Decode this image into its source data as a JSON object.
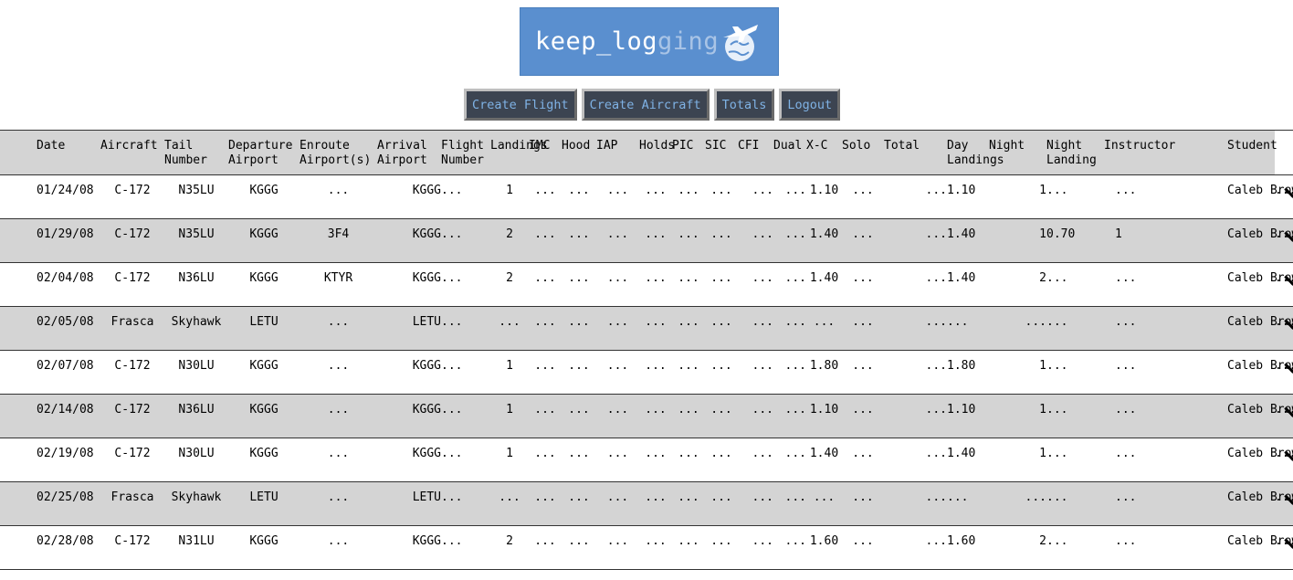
{
  "app": {
    "logo_main": "keep_log",
    "logo_fade": "ging",
    "logo_icon": "airplane-globe-icon"
  },
  "nav": {
    "create_flight": "Create Flight",
    "create_aircraft": "Create Aircraft",
    "totals": "Totals",
    "logout": "Logout"
  },
  "table": {
    "headers": [
      "Date",
      "Aircraft",
      "Tail Number",
      "Departure Airport",
      "Enroute Airport(s)",
      "Arrival Airport",
      "Flight Number",
      "Landings",
      "IMC",
      "Hood",
      "IAP",
      "Holds",
      "PIC",
      "SIC",
      "CFI",
      "Dual",
      "X-C",
      "Solo",
      "Total",
      "Day Landings",
      "Night",
      "Night Landing",
      "Instructor",
      "Student",
      ""
    ],
    "rows": [
      [
        "01/24/08",
        "C-172",
        "N35LU",
        "KGGG",
        "...",
        "KGGG",
        "...",
        "1",
        "...",
        "...",
        "...",
        "...",
        "...",
        "...",
        "...",
        "...",
        "1.10",
        "...",
        "...",
        "1.10",
        "1",
        "...",
        "...",
        "Caleb Brown",
        "..."
      ],
      [
        "01/29/08",
        "C-172",
        "N35LU",
        "KGGG",
        "3F4",
        "KGGG",
        "...",
        "2",
        "...",
        "...",
        "...",
        "...",
        "...",
        "...",
        "...",
        "...",
        "1.40",
        "...",
        "...",
        "1.40",
        "1",
        "0.70",
        "1",
        "Caleb Brown",
        "..."
      ],
      [
        "02/04/08",
        "C-172",
        "N36LU",
        "KGGG",
        "KTYR",
        "KGGG",
        "...",
        "2",
        "...",
        "...",
        "...",
        "...",
        "...",
        "...",
        "...",
        "...",
        "1.40",
        "...",
        "...",
        "1.40",
        "2",
        "...",
        "...",
        "Caleb Brown",
        "..."
      ],
      [
        "02/05/08",
        "Frasca",
        "Skyhawk",
        "LETU",
        "...",
        "LETU",
        "...",
        "...",
        "...",
        "...",
        "...",
        "...",
        "...",
        "...",
        "...",
        "...",
        "...",
        "...",
        "...",
        "...",
        "...",
        "...",
        "...",
        "Caleb Brown",
        "..."
      ],
      [
        "02/07/08",
        "C-172",
        "N30LU",
        "KGGG",
        "...",
        "KGGG",
        "...",
        "1",
        "...",
        "...",
        "...",
        "...",
        "...",
        "...",
        "...",
        "...",
        "1.80",
        "...",
        "...",
        "1.80",
        "1",
        "...",
        "...",
        "Caleb Brown",
        "..."
      ],
      [
        "02/14/08",
        "C-172",
        "N36LU",
        "KGGG",
        "...",
        "KGGG",
        "...",
        "1",
        "...",
        "...",
        "...",
        "...",
        "...",
        "...",
        "...",
        "...",
        "1.10",
        "...",
        "...",
        "1.10",
        "1",
        "...",
        "...",
        "Caleb Brown",
        "..."
      ],
      [
        "02/19/08",
        "C-172",
        "N30LU",
        "KGGG",
        "...",
        "KGGG",
        "...",
        "1",
        "...",
        "...",
        "...",
        "...",
        "...",
        "...",
        "...",
        "...",
        "1.40",
        "...",
        "...",
        "1.40",
        "1",
        "...",
        "...",
        "Caleb Brown",
        "..."
      ],
      [
        "02/25/08",
        "Frasca",
        "Skyhawk",
        "LETU",
        "...",
        "LETU",
        "...",
        "...",
        "...",
        "...",
        "...",
        "...",
        "...",
        "...",
        "...",
        "...",
        "...",
        "...",
        "...",
        "...",
        "...",
        "...",
        "...",
        "Caleb Brown",
        "..."
      ],
      [
        "02/28/08",
        "C-172",
        "N31LU",
        "KGGG",
        "...",
        "KGGG",
        "...",
        "2",
        "...",
        "...",
        "...",
        "...",
        "...",
        "...",
        "...",
        "...",
        "1.60",
        "...",
        "...",
        "1.60",
        "2",
        "...",
        "...",
        "Caleb Brown",
        "..."
      ]
    ],
    "expand_icon": "chevron-down-icon"
  }
}
